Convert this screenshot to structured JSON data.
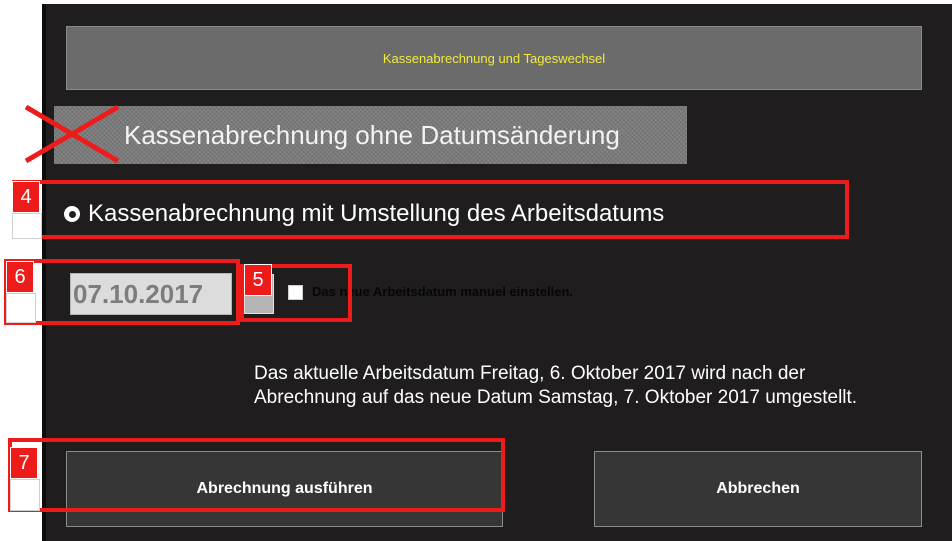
{
  "dialog": {
    "title": "Kassenabrechnung und Tageswechsel",
    "option_without_date_change": "Kassenabrechnung ohne Datumsänderung",
    "option_with_date_change": "Kassenabrechnung mit Umstellung des Arbeitsdatums",
    "selected_option": "option_with_date_change",
    "date_value": "07.10.2017",
    "manual_date_checkbox_label": "Das neue Arbeitsdatum manuel einstellen.",
    "manual_date_checked": false,
    "info_line_1": "Das aktuelle Arbeitsdatum Freitag, 6. Oktober 2017 wird nach der",
    "info_line_2": "Abrechnung auf das neue Datum Samstag, 7. Oktober 2017 umgestellt.",
    "run_button": "Abrechnung ausführen",
    "cancel_button": "Abbrechen"
  },
  "annotations": {
    "badge_4": "4",
    "badge_5": "5",
    "badge_6": "6",
    "badge_7": "7",
    "highlight_color": "#ee1b1b"
  },
  "colors": {
    "background": "#1f1d1d",
    "title_text": "#f2ea3c",
    "button_bg": "#373636"
  }
}
